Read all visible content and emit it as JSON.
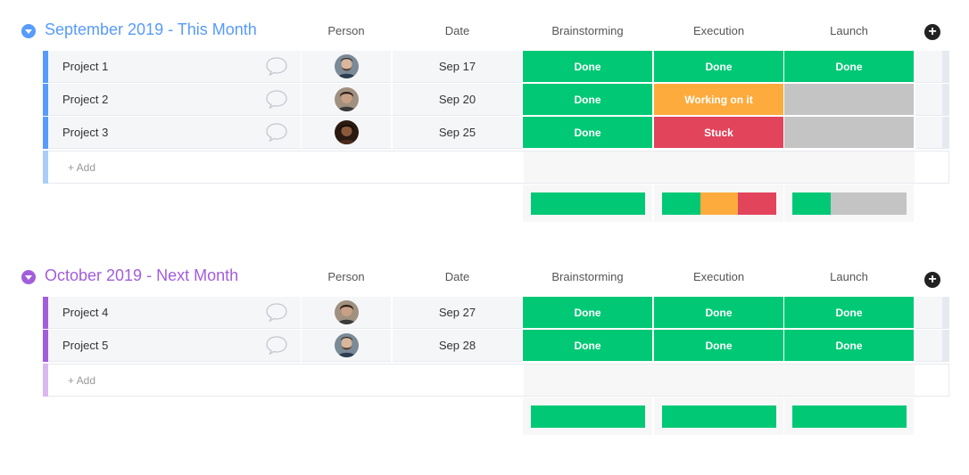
{
  "colors": {
    "done": "#00c875",
    "working": "#fdab3d",
    "stuck": "#e2445c",
    "empty": "#c4c4c4",
    "group1": "#579bfc",
    "group1_light": "#a9cdf8",
    "group2": "#a25ddc",
    "group2_light": "#d9b8f0"
  },
  "columns": {
    "person": "Person",
    "date": "Date",
    "brainstorming": "Brainstorming",
    "execution": "Execution",
    "launch": "Launch"
  },
  "add_column_icon": "plus-circle-icon",
  "groups": [
    {
      "title": "September 2019 - This Month",
      "add_label": "+ Add",
      "rows": [
        {
          "name": "Project 1",
          "date": "Sep 17",
          "brainstorming": "Done",
          "execution": "Done",
          "launch": "Done"
        },
        {
          "name": "Project 2",
          "date": "Sep 20",
          "brainstorming": "Done",
          "execution": "Working on it",
          "launch": ""
        },
        {
          "name": "Project 3",
          "date": "Sep 25",
          "brainstorming": "Done",
          "execution": "Stuck",
          "launch": ""
        }
      ],
      "summary": {
        "brainstorming": [
          {
            "status": "done",
            "fraction": 1
          }
        ],
        "execution": [
          {
            "status": "done",
            "fraction": 0.3333
          },
          {
            "status": "working",
            "fraction": 0.3333
          },
          {
            "status": "stuck",
            "fraction": 0.3334
          }
        ],
        "launch": [
          {
            "status": "done",
            "fraction": 0.3333
          },
          {
            "status": "empty",
            "fraction": 0.6667
          }
        ]
      }
    },
    {
      "title": "October 2019 - Next Month",
      "add_label": "+ Add",
      "rows": [
        {
          "name": "Project 4",
          "date": "Sep 27",
          "brainstorming": "Done",
          "execution": "Done",
          "launch": "Done"
        },
        {
          "name": "Project 5",
          "date": "Sep 28",
          "brainstorming": "Done",
          "execution": "Done",
          "launch": "Done"
        }
      ],
      "summary": {
        "brainstorming": [
          {
            "status": "done",
            "fraction": 1
          }
        ],
        "execution": [
          {
            "status": "done",
            "fraction": 1
          }
        ],
        "launch": [
          {
            "status": "done",
            "fraction": 1
          }
        ]
      }
    }
  ]
}
